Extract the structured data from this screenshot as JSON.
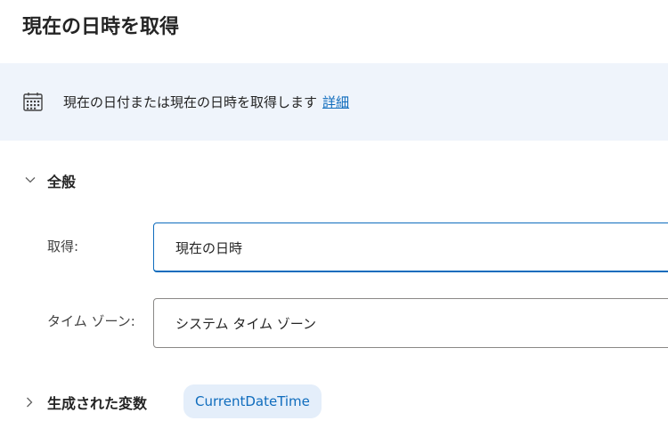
{
  "header": {
    "title": "現在の日時を取得"
  },
  "info": {
    "icon": "calendar-icon",
    "text": "現在の日付または現在の日時を取得します",
    "link_label": "詳細",
    "background": "#eff4fb",
    "link_color": "#0f6cbd"
  },
  "general_section": {
    "toggle_icon": "chevron-down-icon",
    "title": "全般",
    "fields": [
      {
        "label": "取得:",
        "value": "現在の日時",
        "focused": true
      },
      {
        "label": "タイム ゾーン:",
        "value": "システム タイム ゾーン",
        "focused": false
      }
    ]
  },
  "variables_section": {
    "toggle_icon": "chevron-right-icon",
    "title": "生成された変数",
    "variables": [
      "CurrentDateTime"
    ],
    "chip_color": "#e4eefa"
  }
}
